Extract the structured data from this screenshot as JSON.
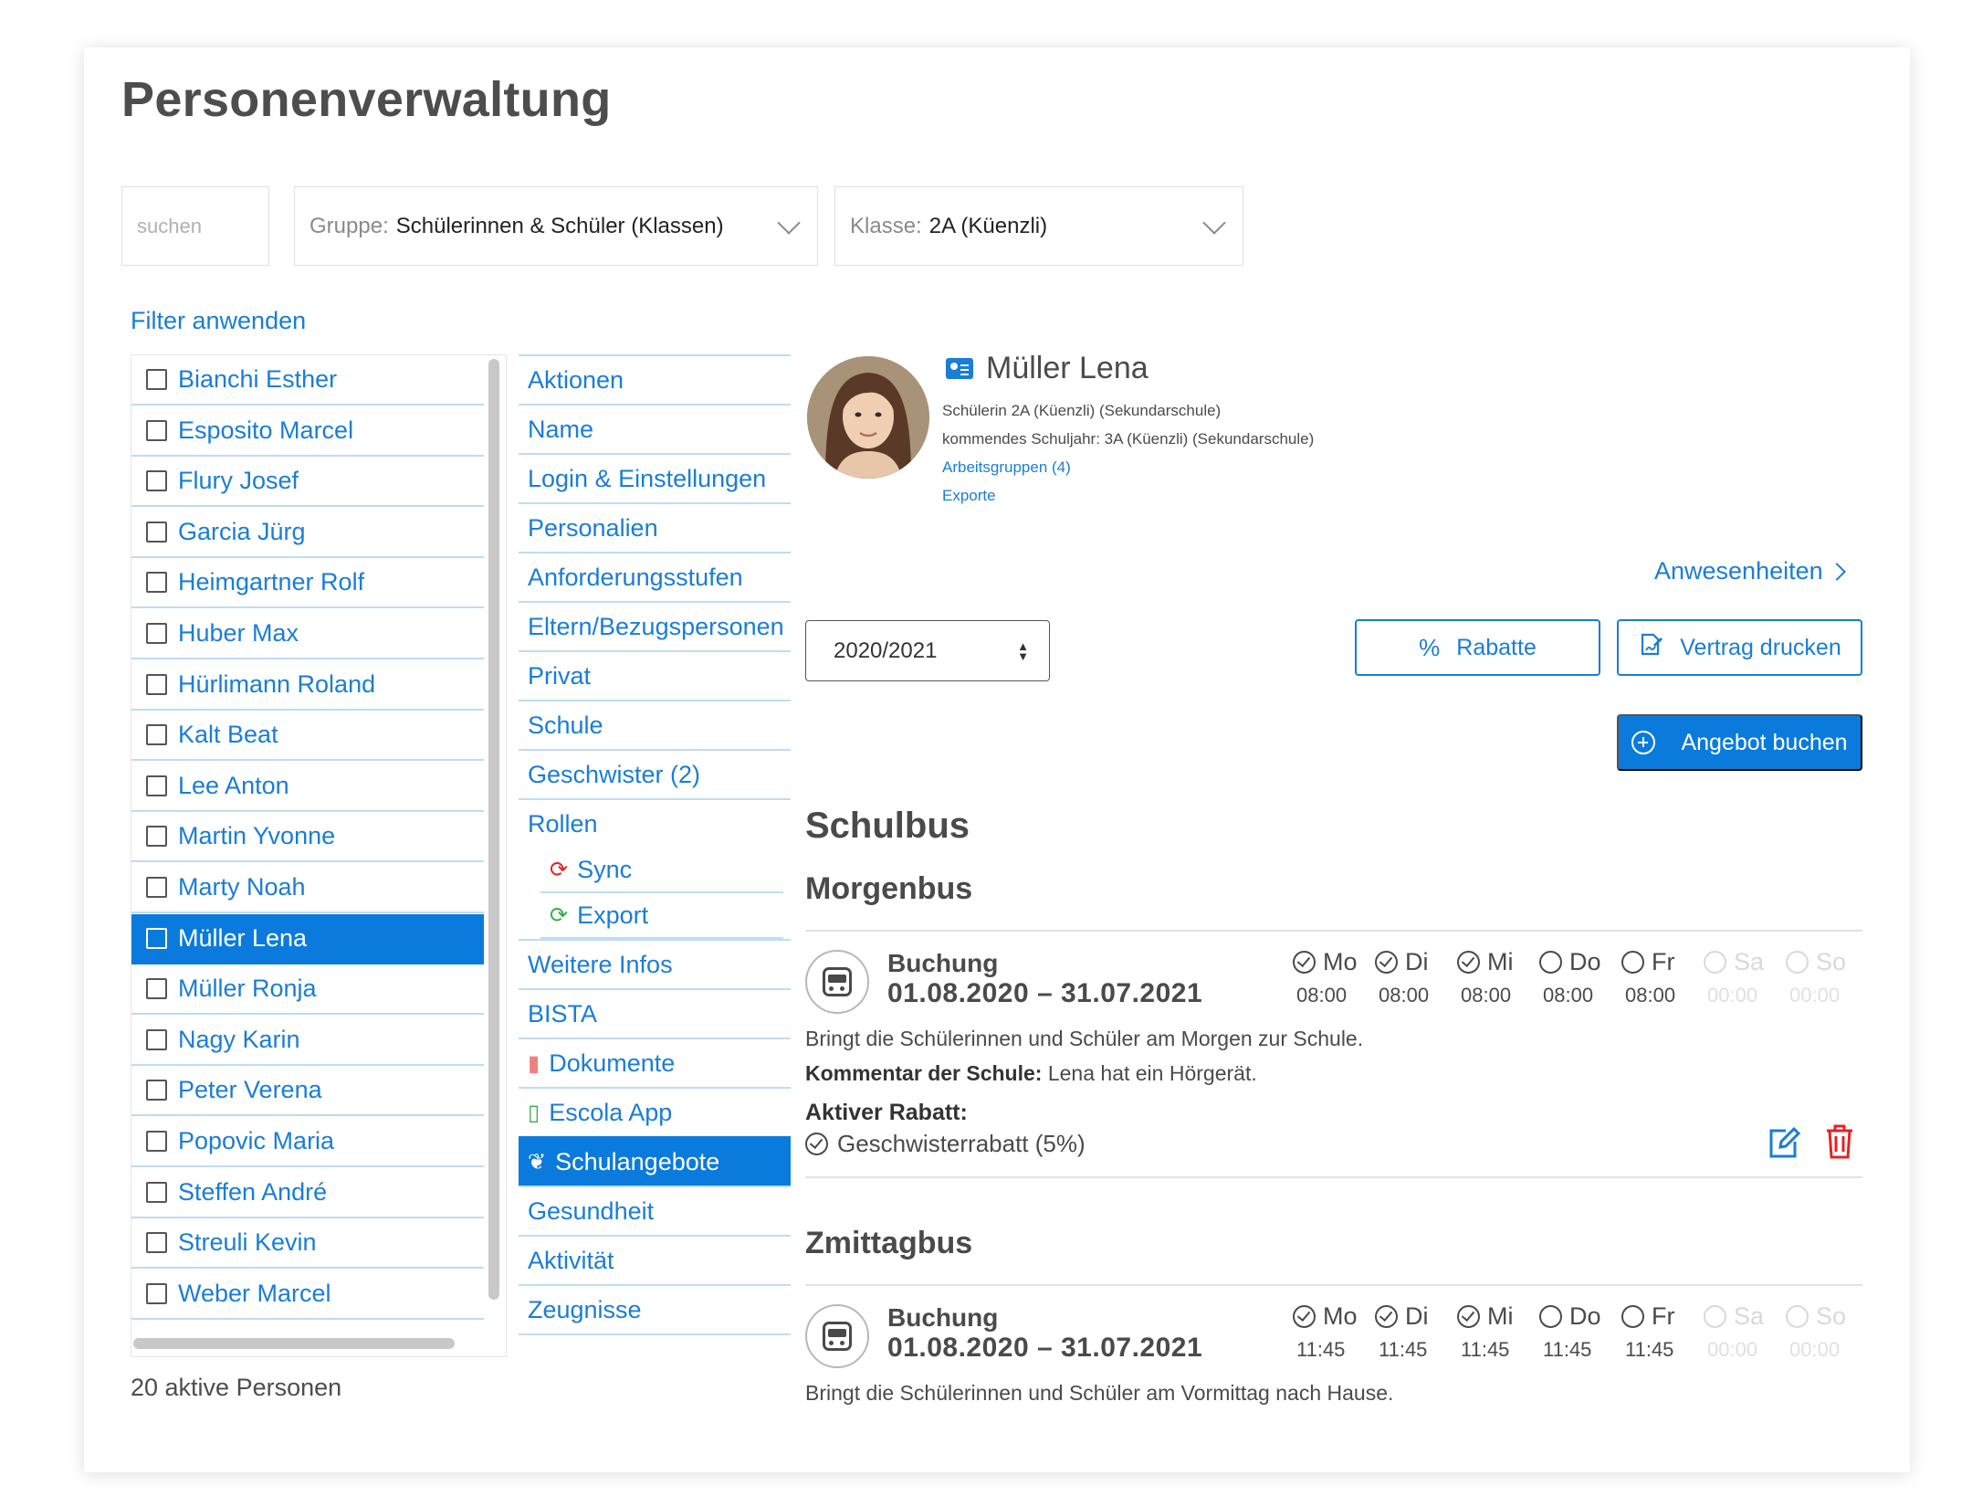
{
  "page": {
    "title": "Personenverwaltung"
  },
  "filters": {
    "search_placeholder": "suchen",
    "group_label": "Gruppe",
    "group_value": "Schülerinnen & Schüler (Klassen)",
    "class_label": "Klasse",
    "class_value": "2A (Küenzli)",
    "apply_label": "Filter anwenden"
  },
  "people": {
    "items": [
      "Bianchi Esther",
      "Esposito Marcel",
      "Flury Josef",
      "Garcia Jürg",
      "Heimgartner Rolf",
      "Huber Max",
      "Hürlimann Roland",
      "Kalt Beat",
      "Lee Anton",
      "Martin Yvonne",
      "Marty Noah",
      "Müller Lena",
      "Müller Ronja",
      "Nagy Karin",
      "Peter Verena",
      "Popovic Maria",
      "Steffen André",
      "Streuli Kevin",
      "Weber Marcel"
    ],
    "selected_index": 11,
    "count_label": "20 aktive Personen"
  },
  "menu": {
    "items": [
      "Aktionen",
      "Name",
      "Login & Einstellungen",
      "Personalien",
      "Anforderungsstufen",
      "Eltern/Bezugspersonen",
      "Privat",
      "Schule",
      "Geschwister (2)",
      "Rollen"
    ],
    "sub_items": [
      "Sync",
      "Export"
    ],
    "items_after": [
      "Weitere Infos",
      "BISTA",
      "Dokumente",
      "Escola App",
      "Schulangebote",
      "Gesundheit",
      "Aktivität",
      "Zeugnisse"
    ],
    "active_label": "Schulangebote"
  },
  "profile": {
    "name": "Müller Lena",
    "line1": "Schülerin 2A (Küenzli) (Sekundarschule)",
    "line2": "kommendes Schuljahr: 3A (Küenzli) (Sekundarschule)",
    "link_groups": "Arbeitsgruppen (4)",
    "link_exports": "Exporte"
  },
  "toolbar": {
    "attendance_label": "Anwesenheiten",
    "year_value": "2020/2021",
    "rabatte_label": "Rabatte",
    "vertrag_label": "Vertrag drucken",
    "angebot_label": "Angebot buchen"
  },
  "schulbus": {
    "title": "Schulbus",
    "morning": {
      "title": "Morgenbus",
      "booking_label": "Buchung",
      "date_range": "01.08.2020 – 31.07.2021",
      "days": [
        {
          "label": "Mo",
          "time": "08:00",
          "checked": true,
          "disabled": false
        },
        {
          "label": "Di",
          "time": "08:00",
          "checked": true,
          "disabled": false
        },
        {
          "label": "Mi",
          "time": "08:00",
          "checked": true,
          "disabled": false
        },
        {
          "label": "Do",
          "time": "08:00",
          "checked": false,
          "disabled": false
        },
        {
          "label": "Fr",
          "time": "08:00",
          "checked": false,
          "disabled": false
        },
        {
          "label": "Sa",
          "time": "00:00",
          "checked": false,
          "disabled": true
        },
        {
          "label": "So",
          "time": "00:00",
          "checked": false,
          "disabled": true
        }
      ],
      "description": "Bringt die Schülerinnen und Schüler am Morgen zur Schule.",
      "comment_label": "Kommentar der Schule:",
      "comment_text": "Lena hat ein Hörgerät.",
      "discount_title": "Aktiver Rabatt:",
      "discount_item": "Geschwisterrabatt (5%)"
    },
    "noon": {
      "title": "Zmittagbus",
      "booking_label": "Buchung",
      "date_range": "01.08.2020 – 31.07.2021",
      "days": [
        {
          "label": "Mo",
          "time": "11:45",
          "checked": true,
          "disabled": false
        },
        {
          "label": "Di",
          "time": "11:45",
          "checked": true,
          "disabled": false
        },
        {
          "label": "Mi",
          "time": "11:45",
          "checked": true,
          "disabled": false
        },
        {
          "label": "Do",
          "time": "11:45",
          "checked": false,
          "disabled": false
        },
        {
          "label": "Fr",
          "time": "11:45",
          "checked": false,
          "disabled": false
        },
        {
          "label": "Sa",
          "time": "00:00",
          "checked": false,
          "disabled": true
        },
        {
          "label": "So",
          "time": "00:00",
          "checked": false,
          "disabled": true
        }
      ],
      "description": "Bringt die Schülerinnen und Schüler am Vormittag nach Hause."
    }
  },
  "colors": {
    "accent": "#0a7bdc",
    "link": "#1a7dd7",
    "danger": "#e02424",
    "success": "#34b04a"
  },
  "icons": [
    "id-card-icon",
    "percent-icon",
    "sign-document-icon",
    "plus-circle-icon",
    "bus-icon",
    "edit-icon",
    "trash-icon",
    "sync-icon",
    "export-icon",
    "document-icon",
    "phone-icon",
    "offers-icon"
  ]
}
